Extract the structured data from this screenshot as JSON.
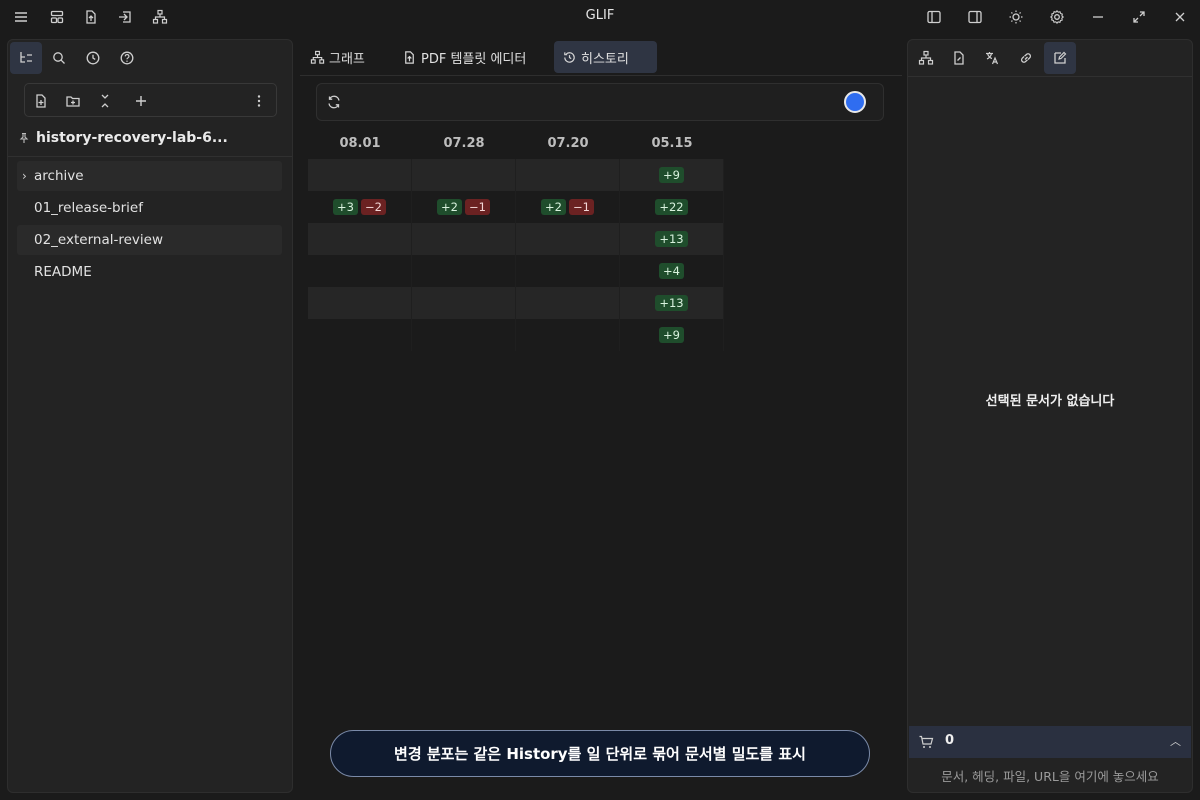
{
  "app": {
    "title": "GLIF"
  },
  "left_panel": {
    "vault_name": "history-recovery-lab-6...",
    "tree": [
      {
        "label": "archive",
        "folder": true
      },
      {
        "label": "01_release-brief",
        "folder": false
      },
      {
        "label": "02_external-review",
        "folder": false
      },
      {
        "label": "README",
        "folder": false
      }
    ]
  },
  "tabs": [
    {
      "label": "그래프",
      "icon": "graph-icon"
    },
    {
      "label": "PDF 템플릿 에디터",
      "icon": "pdf-export-icon"
    },
    {
      "label": "히스토리",
      "icon": "history-icon",
      "active": true
    }
  ],
  "history": {
    "columns": [
      "08.01",
      "07.28",
      "07.20",
      "05.15"
    ],
    "rows": [
      [
        [],
        [],
        [],
        [
          "+9"
        ]
      ],
      [
        [
          "+3",
          "−2"
        ],
        [
          "+2",
          "−1"
        ],
        [
          "+2",
          "−1"
        ],
        [
          "+22"
        ]
      ],
      [
        [],
        [],
        [],
        [
          "+13"
        ]
      ],
      [
        [],
        [],
        [],
        [
          "+4"
        ]
      ],
      [
        [],
        [],
        [],
        [
          "+13"
        ]
      ],
      [
        [],
        [],
        [],
        [
          "+9"
        ]
      ]
    ],
    "toast": "변경 분포는 같은 History를 일 단위로 묶어 문서별 밀도를 표시"
  },
  "right_panel": {
    "empty_message": "선택된 문서가 없습니다",
    "cart_count": "0",
    "drop_hint": "문서, 헤딩, 파일, URL을 여기에 놓으세요"
  },
  "colors": {
    "accent": "#2f6df0",
    "add_badge": "#1f4d2c",
    "del_badge": "#6b2222",
    "active_tab": "#2f3543"
  }
}
